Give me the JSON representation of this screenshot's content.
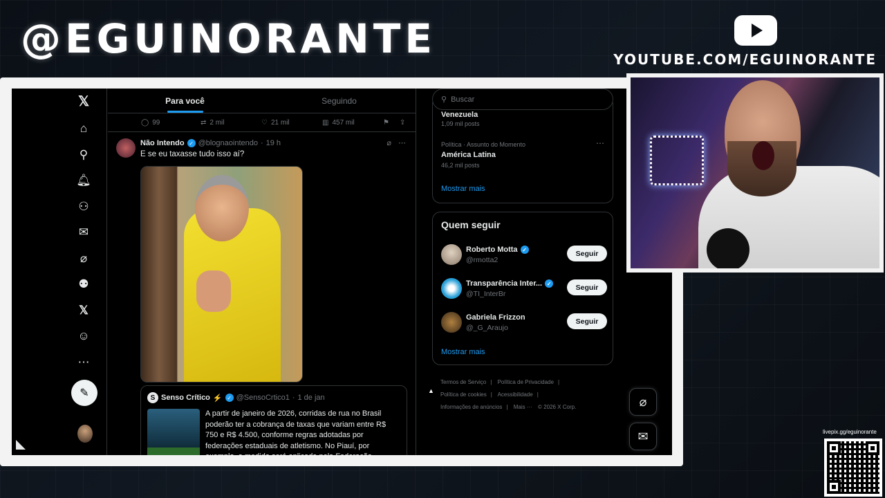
{
  "overlay": {
    "brand": "@EGUINORANTE",
    "youtube_url": "YOUTUBE.COM/EGUINORANTE",
    "livepix": "livepix.gg/eguinorante"
  },
  "tabs": [
    "Para você",
    "Seguindo"
  ],
  "prev_actions": {
    "replies": "99",
    "reposts": "2 mil",
    "likes": "21 mil",
    "views": "457 mil"
  },
  "tweet": {
    "name": "Não Intendo",
    "handle": "@blognaointendo",
    "time": "19 h",
    "text": "E se eu taxasse tudo isso aí?"
  },
  "quote": {
    "name": "Senso Crítico",
    "emoji": "⚡",
    "handle": "@SensoCrtico1",
    "time": "1 de jan",
    "text": "A partir de janeiro de 2026, corridas de rua no Brasil poderão ter a cobrança de taxas que variam entre R$ 750 e R$ 4.500, conforme regras adotadas por federações estaduais de atletismo. No Piauí, por exemplo, a medida será aplicada pela Federação"
  },
  "search": {
    "placeholder": "Buscar"
  },
  "trends": {
    "partial_title": "Venezuela",
    "partial_posts": "1,09 mil posts",
    "item_meta": "Política · Assunto do Momento",
    "item_title": "América Latina",
    "item_posts": "46,2 mil posts",
    "show_more": "Mostrar mais"
  },
  "who_to_follow": {
    "title": "Quem seguir",
    "button": "Seguir",
    "people": [
      {
        "name": "Roberto Motta",
        "handle": "@rmotta2"
      },
      {
        "name": "Transparência Inter...",
        "handle": "@TI_InterBr"
      },
      {
        "name": "Gabriela Frizzon",
        "handle": "@_G_Araujo"
      }
    ],
    "show_more": "Mostrar mais"
  },
  "footer": [
    "Termos de Serviço",
    "|",
    "Política de Privacidade",
    "|",
    "Política de cookies",
    "|",
    "Acessibilidade",
    "|",
    "Informações de anúncios",
    "|",
    "Mais ···",
    "© 2026 X Corp."
  ],
  "colors": {
    "accent": "#1d9bf0",
    "bg": "#000000"
  }
}
